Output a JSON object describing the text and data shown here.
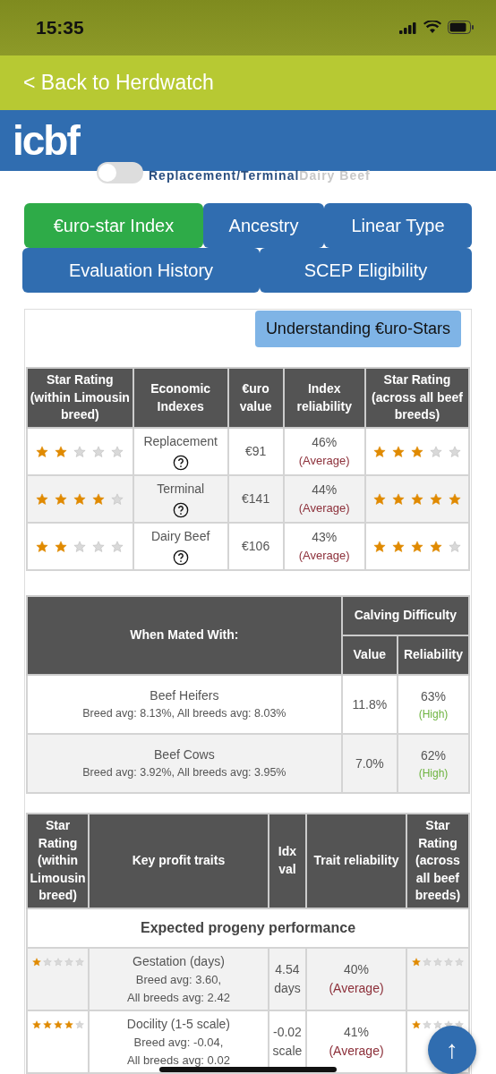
{
  "status_bar": {
    "time": "15:35"
  },
  "back_link": "< Back to Herdwatch",
  "header": {
    "logo": "icbf"
  },
  "toggle": {
    "on": false,
    "left_label": "Replacement/Terminal",
    "right_label": "Dairy Beef"
  },
  "tabs": [
    {
      "label": "€uro-star Index",
      "selected": true
    },
    {
      "label": "Ancestry",
      "selected": false
    },
    {
      "label": "Linear Type",
      "selected": false
    },
    {
      "label": "Evaluation History",
      "selected": false
    },
    {
      "label": "SCEP Eligibility",
      "selected": false
    }
  ],
  "help_button": "Understanding €uro-Stars",
  "index_table": {
    "columns": [
      "Star Rating (within Limousin breed)",
      "Economic Indexes",
      "€uro value",
      "Index reliability",
      "Star Rating (across all beef breeds)"
    ],
    "rows": [
      {
        "stars_within": {
          "stars": 2
        },
        "index": "Replacement",
        "value": "€91",
        "reliability": "46%",
        "rating": "(Average)",
        "color": "#8c2f39",
        "stars_across": {
          "stars": 3
        }
      },
      {
        "stars_within": {
          "stars": 4
        },
        "index": "Terminal",
        "value": "€141",
        "reliability": "44%",
        "rating": "(Average)",
        "color": "#8c2f39",
        "stars_across": {
          "stars": 5
        }
      },
      {
        "stars_within": {
          "stars": 2
        },
        "index": "Dairy Beef",
        "value": "€106",
        "reliability": "43%",
        "rating": "(Average)",
        "color": "#8c2f39",
        "stars_across": {
          "stars": 4
        }
      }
    ]
  },
  "calving_table": {
    "columns": [
      "When Mated With:",
      "Calving Difficulty",
      "Value",
      "Reliability"
    ],
    "rows": [
      {
        "group": "Beef Heifers",
        "averages": "Breed avg: 8.13%, All breeds avg: 8.03%",
        "value": "11.8%",
        "reliability": "63%",
        "rating": "(High)",
        "color": "#6db33f"
      },
      {
        "group": "Beef Cows",
        "averages": "Breed avg: 3.92%, All breeds avg: 3.95%",
        "value": "7.0%",
        "reliability": "62%",
        "rating": "(High)",
        "color": "#6db33f"
      }
    ]
  },
  "traits_table": {
    "columns": [
      "Star Rating (within Limousin breed)",
      "Key profit traits",
      "Idx val",
      "Trait reliability",
      "Star Rating (across all beef breeds)"
    ],
    "section": "Expected progeny performance",
    "rows": [
      {
        "stars_within": {
          "stars": 1
        },
        "trait": "Gestation (days)",
        "breed_avg": "Breed avg: 3.60,",
        "all_avg": "All breeds avg: 2.42",
        "value": "4.54",
        "unit": "days",
        "reliability": "40%",
        "rating": "(Average)",
        "color": "#8c2f39",
        "stars_across": {
          "stars": 1
        }
      },
      {
        "stars_within": {
          "stars": 4
        },
        "trait": "Docility (1-5 scale)",
        "breed_avg": "Breed avg: -0.04,",
        "all_avg": "All breeds avg: 0.02",
        "value": "-0.02",
        "unit": "scale",
        "reliability": "41%",
        "rating": "(Average)",
        "color": "#8c2f39",
        "stars_across": {
          "stars": 1
        }
      }
    ]
  },
  "scroll_top_button": "↑"
}
